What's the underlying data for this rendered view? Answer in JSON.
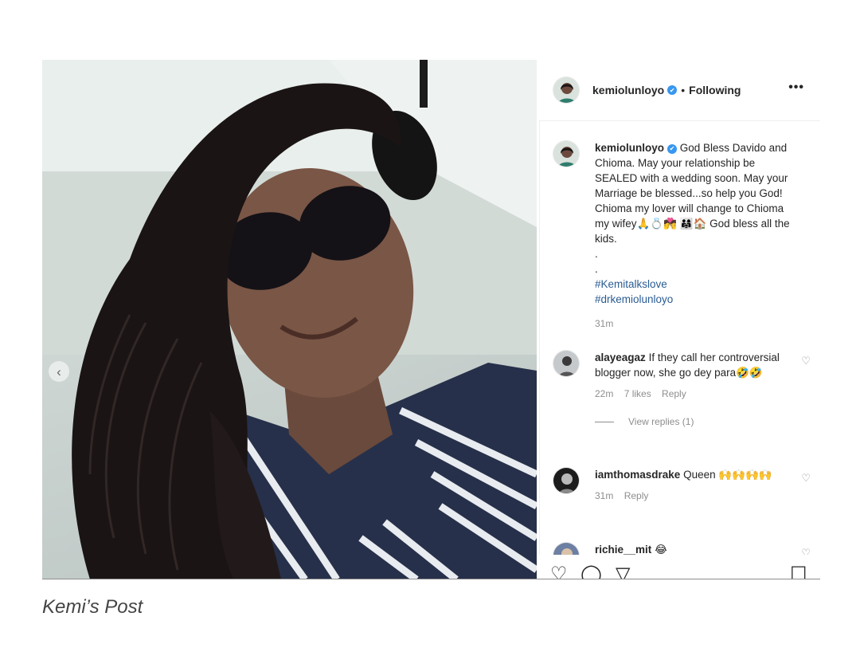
{
  "header": {
    "username": "kemiolunloyo",
    "verified_glyph": "✔",
    "separator": "•",
    "follow_status": "Following",
    "more_glyph": "•••"
  },
  "carousel": {
    "prev_glyph": "‹"
  },
  "post_caption": {
    "username": "kemiolunloyo",
    "text_1": "God Bless Davido and Chioma. May your relationship be SEALED with a wedding soon. May your Marriage be blessed...so help you God! Chioma my lover will change to Chioma my wifey🙏💍💏",
    "text_2": "👨‍👩‍👧🏠 God bless all the kids.",
    "dot_1": ".",
    "dot_2": ".",
    "hashtags": [
      "#Kemitalkslove",
      "#drkemiolunloyo"
    ],
    "time": "31m"
  },
  "comments": [
    {
      "username": "alayeagaz",
      "text": "If they call her controversial blogger now, she go dey para🤣🤣",
      "time": "22m",
      "likes": "7 likes",
      "reply": "Reply",
      "view_replies": "View replies (1)"
    },
    {
      "username": "iamthomasdrake",
      "text": "Queen 🙌🙌🙌🙌",
      "time": "31m",
      "reply": "Reply"
    },
    {
      "username": "richie__mit",
      "text": "😂"
    }
  ],
  "icons": {
    "heart": "♡",
    "like": "♡",
    "comment": "◯",
    "share": "▽",
    "save": "☐"
  },
  "figure_caption": "Kemi’s Post"
}
